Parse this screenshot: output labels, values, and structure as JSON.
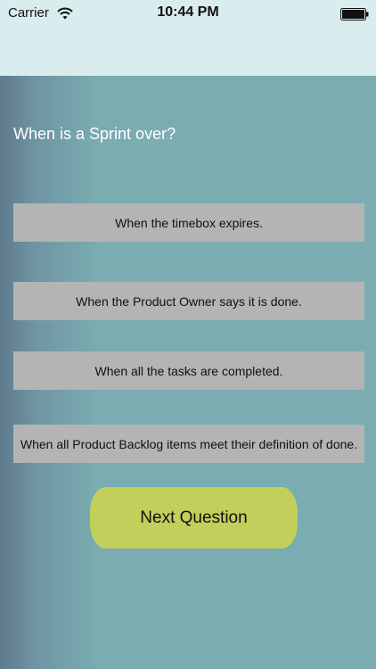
{
  "status_bar": {
    "carrier": "Carrier",
    "time": "10:44 PM"
  },
  "quiz": {
    "question": "When is a Sprint over?",
    "answers": [
      "When the timebox expires.",
      "When the Product Owner says it is done.",
      "When all the tasks are completed.",
      "When all Product Backlog items meet their definition of done."
    ],
    "next_label": "Next Question"
  },
  "colors": {
    "header_bg": "#d9ecee",
    "content_bg": "#7aacb1",
    "answer_bg": "#b4b4b4",
    "button_bg": "#c2cf5a"
  }
}
